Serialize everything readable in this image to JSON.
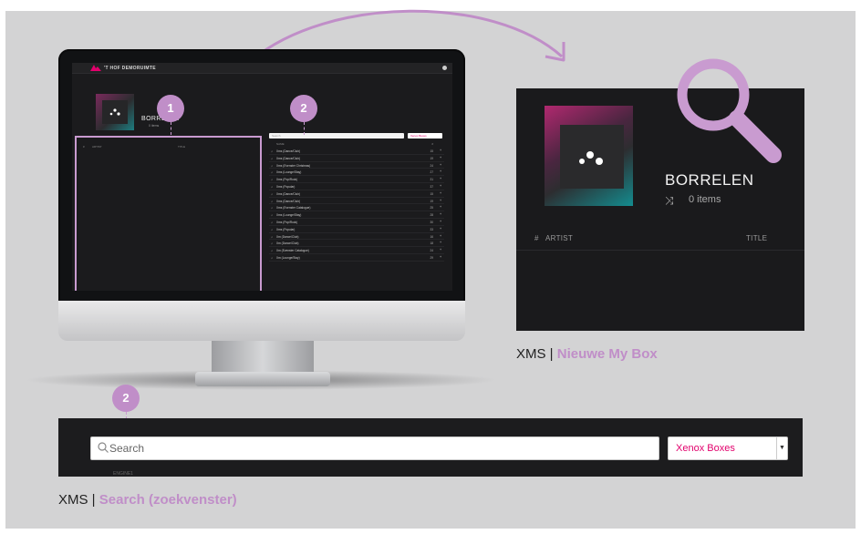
{
  "colors": {
    "accent": "#c08ec8",
    "brand_pink": "#e2006c",
    "panel_bg": "#d3d3d4",
    "app_bg": "#1a1a1c"
  },
  "mini_app": {
    "brand": "'T HOF DEMORUIMTE",
    "box_title": "BORRELEN",
    "box_count": "0 items",
    "left_headers": {
      "hash": "#",
      "artist": "ARTIST",
      "title": "TITLE"
    },
    "search_placeholder": "Search",
    "select_value": "Xenox Boxes",
    "right_header_name": "NAME",
    "right_header_hash": "#",
    "rows": [
      {
        "name": "Xms (Dance/Club)",
        "count": "15"
      },
      {
        "name": "Xms (Dance/Club)",
        "count": "19"
      },
      {
        "name": "Xms (Evenster Christmas)",
        "count": "24"
      },
      {
        "name": "Xms (Lounge/Stay)",
        "count": "27"
      },
      {
        "name": "Xms (Pop/Rock)",
        "count": "31"
      },
      {
        "name": "Xms (Popular)",
        "count": "37"
      },
      {
        "name": "Xms (Dance/Club)",
        "count": "15"
      },
      {
        "name": "Xms (Dance/Club)",
        "count": "19"
      },
      {
        "name": "Xms (Evenster Catalogue)",
        "count": "25"
      },
      {
        "name": "Xms (Lounge/Stay)",
        "count": "28"
      },
      {
        "name": "Xms (Pop/Rock)",
        "count": "30"
      },
      {
        "name": "Xms (Popular)",
        "count": "33"
      },
      {
        "name": "Xm (Dance/Club)",
        "count": "16"
      },
      {
        "name": "Xm (Dance/Club)",
        "count": "18"
      },
      {
        "name": "Xm (Evenster Catalogue)",
        "count": "24"
      },
      {
        "name": "Xm (Lounge/Stay)",
        "count": "29"
      }
    ]
  },
  "badges": {
    "one": "1",
    "two": "2",
    "two_bottom": "2"
  },
  "zoom": {
    "box_title": "BORRELEN",
    "count": "0 items",
    "header_hash": "#",
    "header_artist": "ARTIST",
    "header_title": "TITLE"
  },
  "captions": {
    "my_box_prefix": "XMS |",
    "my_box_highlight": "Nieuwe My Box",
    "search_prefix": "XMS |",
    "search_highlight": "Search (zoekvenster)"
  },
  "search_strip": {
    "placeholder": "Search",
    "select_value": "Xenox Boxes",
    "peek_text": "ENGINE1"
  },
  "icons": [
    "logo-icon",
    "user-icon",
    "shuffle-icon",
    "search-icon",
    "magnifier-illustration-icon",
    "chevron-down-icon",
    "arrow-curve-icon",
    "music-note-icon",
    "plus-icon"
  ]
}
